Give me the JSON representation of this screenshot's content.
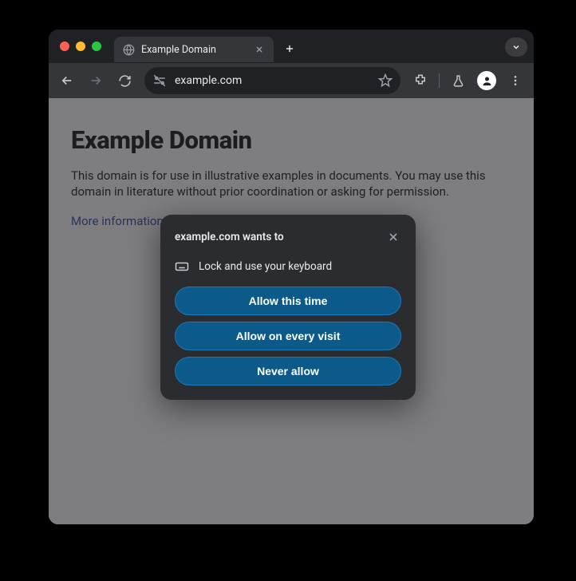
{
  "tab": {
    "title": "Example Domain"
  },
  "toolbar": {
    "url": "example.com"
  },
  "page": {
    "heading": "Example Domain",
    "paragraph": "This domain is for use in illustrative examples in documents. You may use this domain in literature without prior coordination or asking for permission.",
    "link": "More information..."
  },
  "permission": {
    "title": "example.com wants to",
    "request": "Lock and use your keyboard",
    "allow_once": "Allow this time",
    "allow_always": "Allow on every visit",
    "never": "Never allow"
  }
}
